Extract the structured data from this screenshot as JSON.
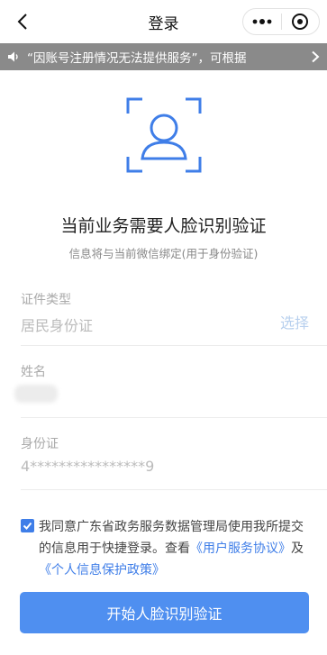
{
  "header": {
    "title": "登录"
  },
  "notice": {
    "text": "“因账号注册情况无法提供服务”，可根据"
  },
  "main": {
    "headline": "当前业务需要人脸识别验证",
    "subline": "信息将与当前微信绑定(用于身份验证)"
  },
  "form": {
    "id_type": {
      "label": "证件类型",
      "value": "居民身份证",
      "action": "选择"
    },
    "name": {
      "label": "姓名"
    },
    "id_number": {
      "label": "身份证",
      "value": "4****************9"
    }
  },
  "agreement": {
    "checked": true,
    "text_before": "我同意广东省政务服务数据管理局使用我所提交的信息用于快捷登录。查看",
    "link_service": "《用户服务协议》",
    "and": "及",
    "link_privacy": "《个人信息保护政策》"
  },
  "cta": {
    "label": "开始人脸识别验证"
  },
  "colors": {
    "accent": "#4f8ff0",
    "notice_bg": "#8a8a8a"
  }
}
